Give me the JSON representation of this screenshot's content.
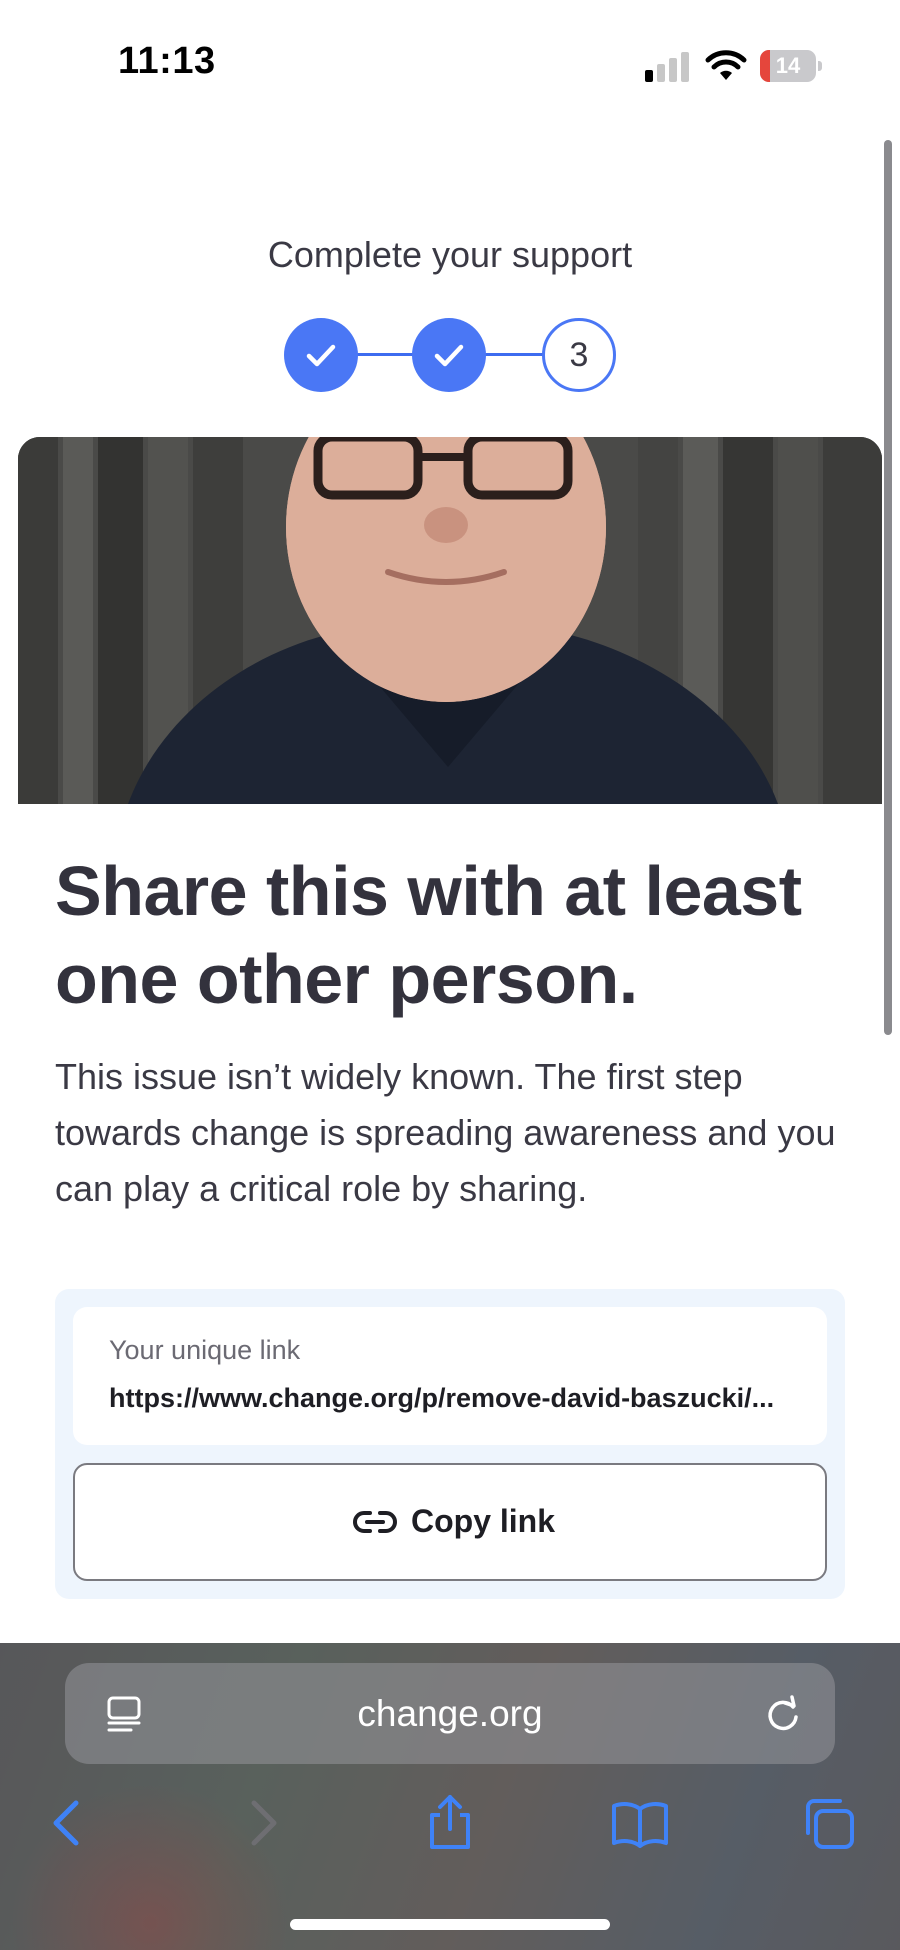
{
  "status_bar": {
    "time": "11:13",
    "battery": "14",
    "battery_level": 0.14
  },
  "progress": {
    "title": "Complete your support",
    "steps": [
      {
        "state": "done"
      },
      {
        "state": "done"
      },
      {
        "state": "current",
        "label": "3"
      }
    ]
  },
  "card": {
    "headline": "Share this with at least one other person.",
    "body": "This issue isn’t widely known. The first step towards change is spreading awareness and you can play a critical role by sharing.",
    "link_label": "Your unique link",
    "link_url": "https://www.change.org/p/remove-david-baszucki/...",
    "copy_button": "Copy link"
  },
  "browser": {
    "address": "change.org",
    "icons": [
      "tabs-overview-icon",
      "reload-icon",
      "back-icon",
      "forward-icon",
      "share-icon",
      "bookmarks-icon",
      "tabs-icon"
    ]
  },
  "colors": {
    "accent": "#4a77f5",
    "text": "#33323d",
    "share_box": "#eef5fd",
    "battery_low": "#e5463c"
  }
}
